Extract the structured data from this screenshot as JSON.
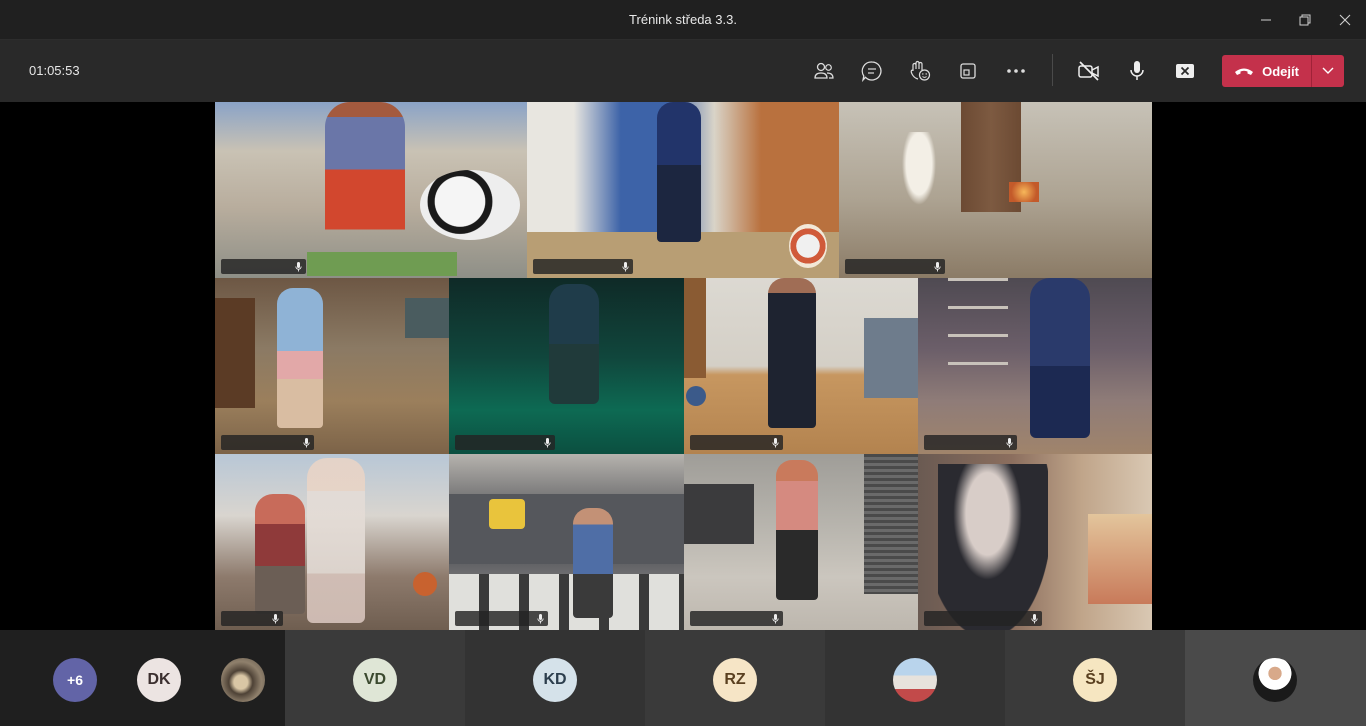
{
  "window": {
    "title": "Trénink středa 3.3."
  },
  "callbar": {
    "timer": "01:05:53",
    "leave_label": "Odejít"
  },
  "roster": {
    "overflow_label": "+6",
    "initials": [
      "DK",
      "VD",
      "KD",
      "RZ",
      "ŠJ"
    ]
  },
  "colors": {
    "leave_red": "#c4314b",
    "overflow_purple": "#6264a7",
    "titlebar": "#202020",
    "callbar": "#292929"
  },
  "icons": [
    "participants-icon",
    "chat-icon",
    "reactions-icon",
    "share-tray-icon",
    "more-options-icon",
    "camera-off-icon",
    "microphone-icon",
    "share-screen-icon",
    "hang-up-icon",
    "chevron-down-icon",
    "microphone-small-icon",
    "minimize-icon",
    "restore-icon",
    "close-icon"
  ]
}
